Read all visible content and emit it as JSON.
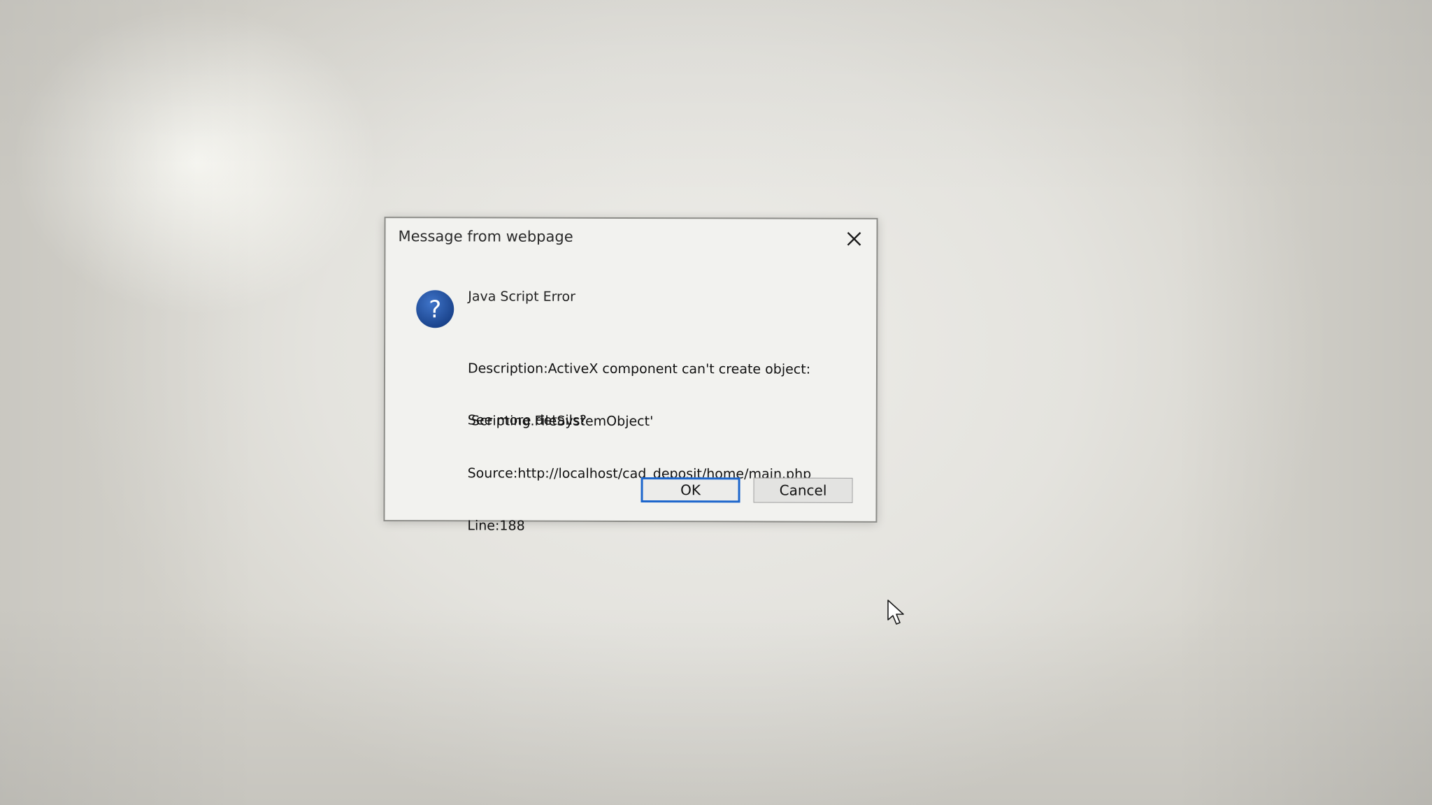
{
  "dialog": {
    "title": "Message from webpage",
    "close_icon": "close-icon",
    "icon": "question-icon",
    "heading": "Java Script Error",
    "description_lines": [
      "Description:ActiveX component can't create object:",
      "'Scripting.FileSystemObject'",
      "Source:http://localhost/cad_deposit/home/main.php",
      "Line:188"
    ],
    "prompt": "See more details?",
    "buttons": {
      "ok_label": "OK",
      "cancel_label": "Cancel"
    }
  },
  "colors": {
    "icon_blue": "#1f4f9e",
    "focus_border": "#1d66cc"
  },
  "cursor": "arrow-pointer-icon"
}
